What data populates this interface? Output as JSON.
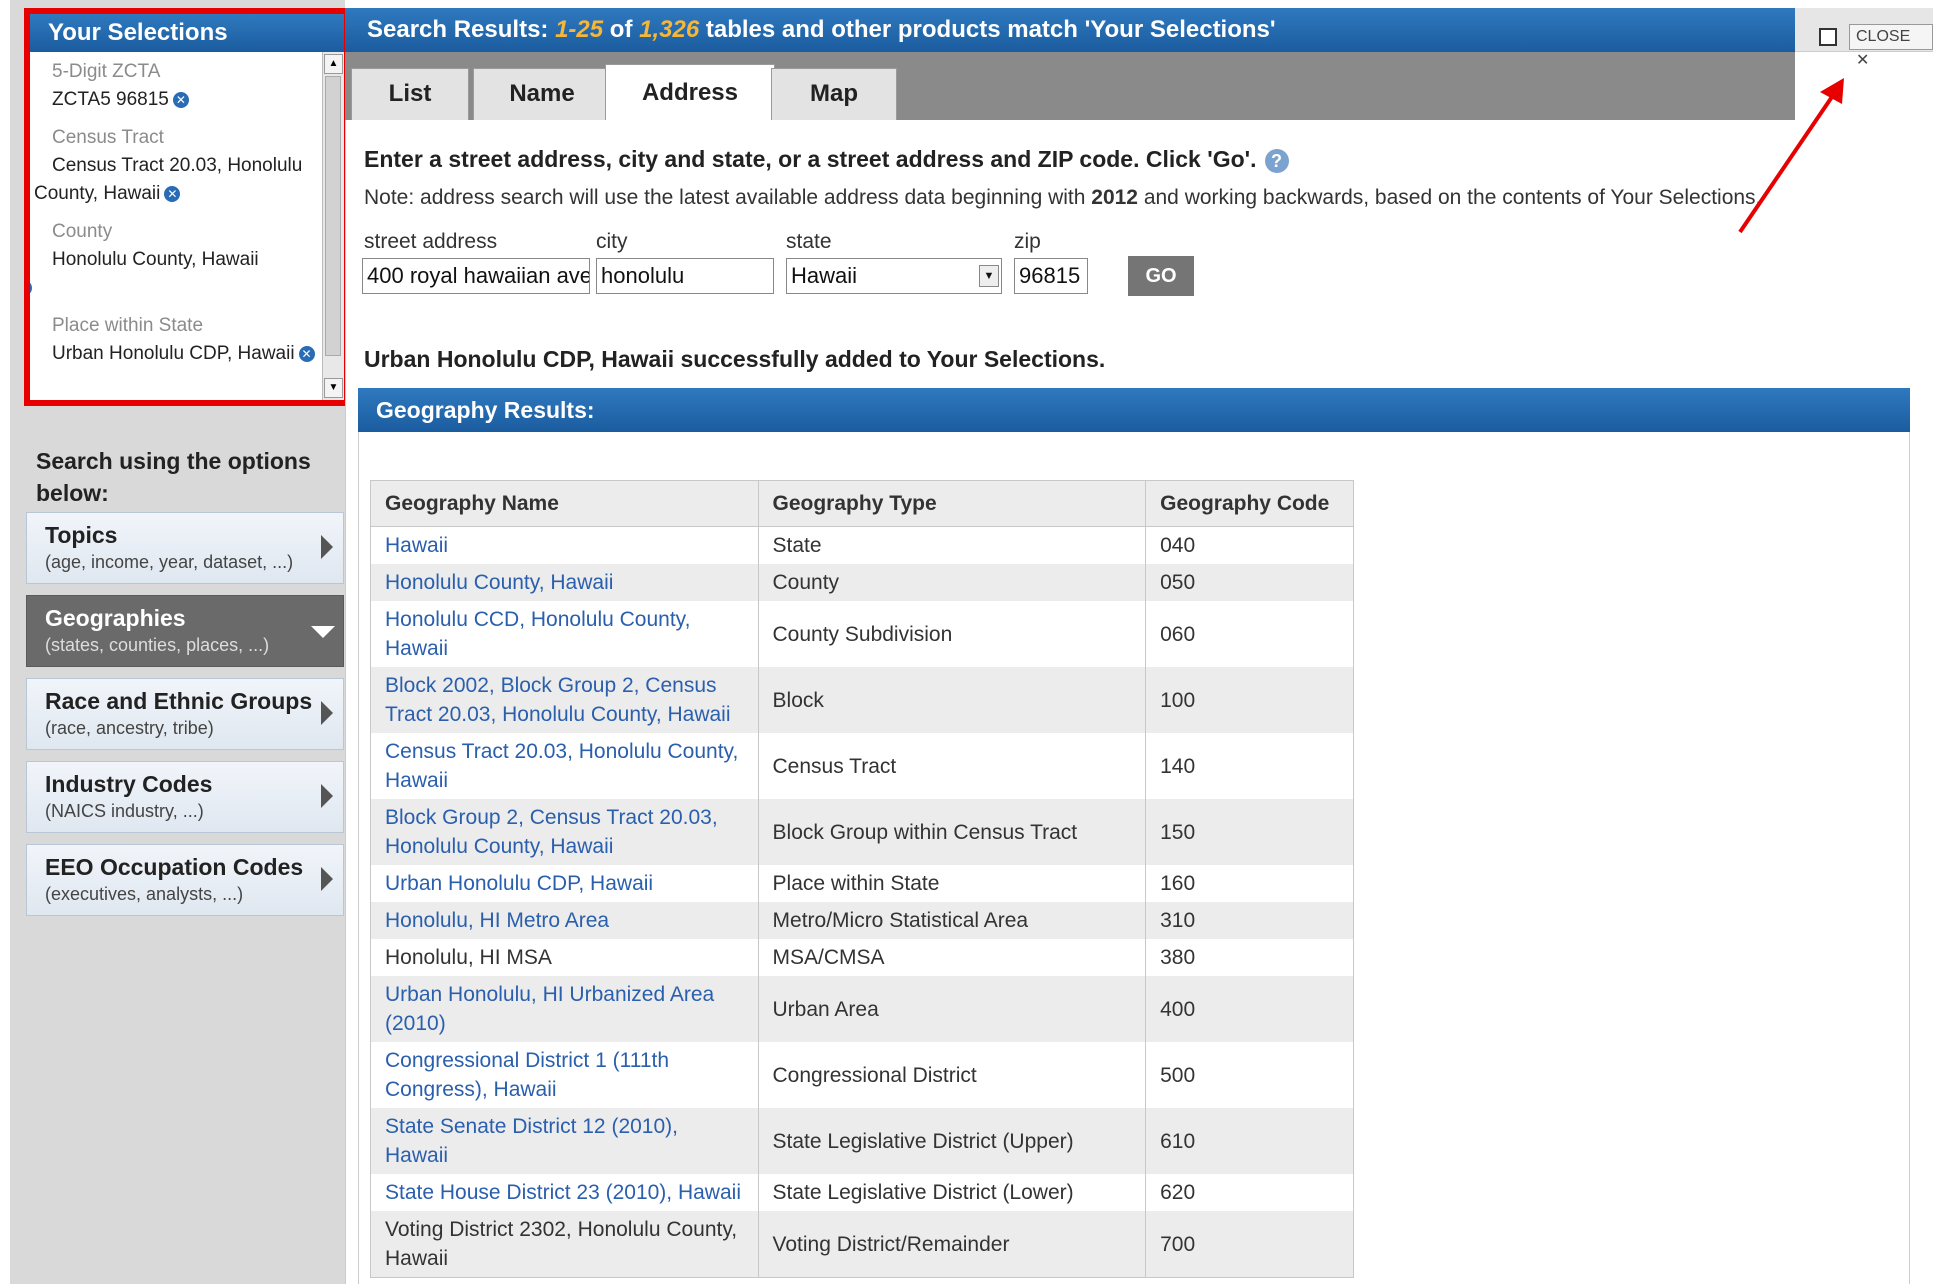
{
  "selections": {
    "title": "Your Selections",
    "items": [
      {
        "type": "5-Digit ZCTA",
        "value": "ZCTA5 96815"
      },
      {
        "type": "Census Tract",
        "value": "Census Tract 20.03, Honolulu County, Hawaii"
      },
      {
        "type": "County",
        "value": "Honolulu County, Hawaii"
      },
      {
        "type": "Place within State",
        "value": "Urban Honolulu CDP, Hawaii"
      }
    ]
  },
  "search": {
    "heading": "Search using the options below:",
    "options": [
      {
        "title": "Topics",
        "sub": "(age, income, year, dataset, ...)"
      },
      {
        "title": "Geographies",
        "sub": "(states, counties, places, ...)"
      },
      {
        "title": "Race and Ethnic Groups",
        "sub": "(race, ancestry, tribe)"
      },
      {
        "title": "Industry Codes",
        "sub": "(NAICS industry, ...)"
      },
      {
        "title": "EEO Occupation Codes",
        "sub": "(executives, analysts, ...)"
      }
    ]
  },
  "results_header": {
    "prefix": "Search Results:",
    "range": "1-25",
    "of": "of",
    "count": "1,326",
    "suffix": "tables and other products match 'Your Selections'"
  },
  "close_label": "CLOSE ✕",
  "tabs": [
    "List",
    "Name",
    "Address",
    "Map"
  ],
  "address_form": {
    "instruction": "Enter a street address, city and state, or a street address and ZIP code. Click 'Go'.",
    "note_prefix": "Note: address search will use the latest available address data beginning with ",
    "note_year": "2012",
    "note_suffix": " and working backwards, based on the contents of Your Selections.",
    "labels": {
      "street": "street address",
      "city": "city",
      "state": "state",
      "zip": "zip"
    },
    "values": {
      "street": "400 royal hawaiian ave.",
      "city": "honolulu",
      "state": "Hawaii",
      "zip": "96815"
    },
    "go_label": "GO"
  },
  "success_message": "Urban Honolulu CDP, Hawaii successfully added to Your Selections.",
  "geo_results": {
    "title": "Geography Results:",
    "columns": [
      "Geography Name",
      "Geography Type",
      "Geography Code"
    ],
    "rows": [
      {
        "name": "Hawaii",
        "type": "State",
        "code": "040"
      },
      {
        "name": "Honolulu County, Hawaii",
        "type": "County",
        "code": "050"
      },
      {
        "name": "Honolulu CCD, Honolulu County, Hawaii",
        "type": "County Subdivision",
        "code": "060"
      },
      {
        "name": "Block 2002, Block Group 2, Census Tract 20.03, Honolulu County, Hawaii",
        "type": "Block",
        "code": "100"
      },
      {
        "name": "Census Tract 20.03, Honolulu County, Hawaii",
        "type": "Census Tract",
        "code": "140"
      },
      {
        "name": "Block Group 2, Census Tract 20.03, Honolulu County, Hawaii",
        "type": "Block Group within Census Tract",
        "code": "150"
      },
      {
        "name": "Urban Honolulu CDP, Hawaii",
        "type": "Place within State",
        "code": "160"
      },
      {
        "name": "Honolulu, HI Metro Area",
        "type": "Metro/Micro Statistical Area",
        "code": "310"
      },
      {
        "name": "Honolulu, HI MSA",
        "type": "MSA/CMSA",
        "code": "380"
      },
      {
        "name": "Urban Honolulu, HI Urbanized Area (2010)",
        "type": "Urban Area",
        "code": "400"
      },
      {
        "name": "Congressional District 1 (111th Congress), Hawaii",
        "type": "Congressional District",
        "code": "500"
      },
      {
        "name": "State Senate District 12 (2010), Hawaii",
        "type": "State Legislative District (Upper)",
        "code": "610"
      },
      {
        "name": "State House District 23 (2010), Hawaii",
        "type": "State Legislative District (Lower)",
        "code": "620"
      },
      {
        "name": "Voting District 2302, Honolulu County, Hawaii",
        "type": "Voting District/Remainder",
        "code": "700"
      }
    ]
  },
  "colors": {
    "header_blue": "#1b5c9f",
    "link": "#2a5fad",
    "highlight": "#e60000",
    "accent_number": "#f5b63a"
  }
}
